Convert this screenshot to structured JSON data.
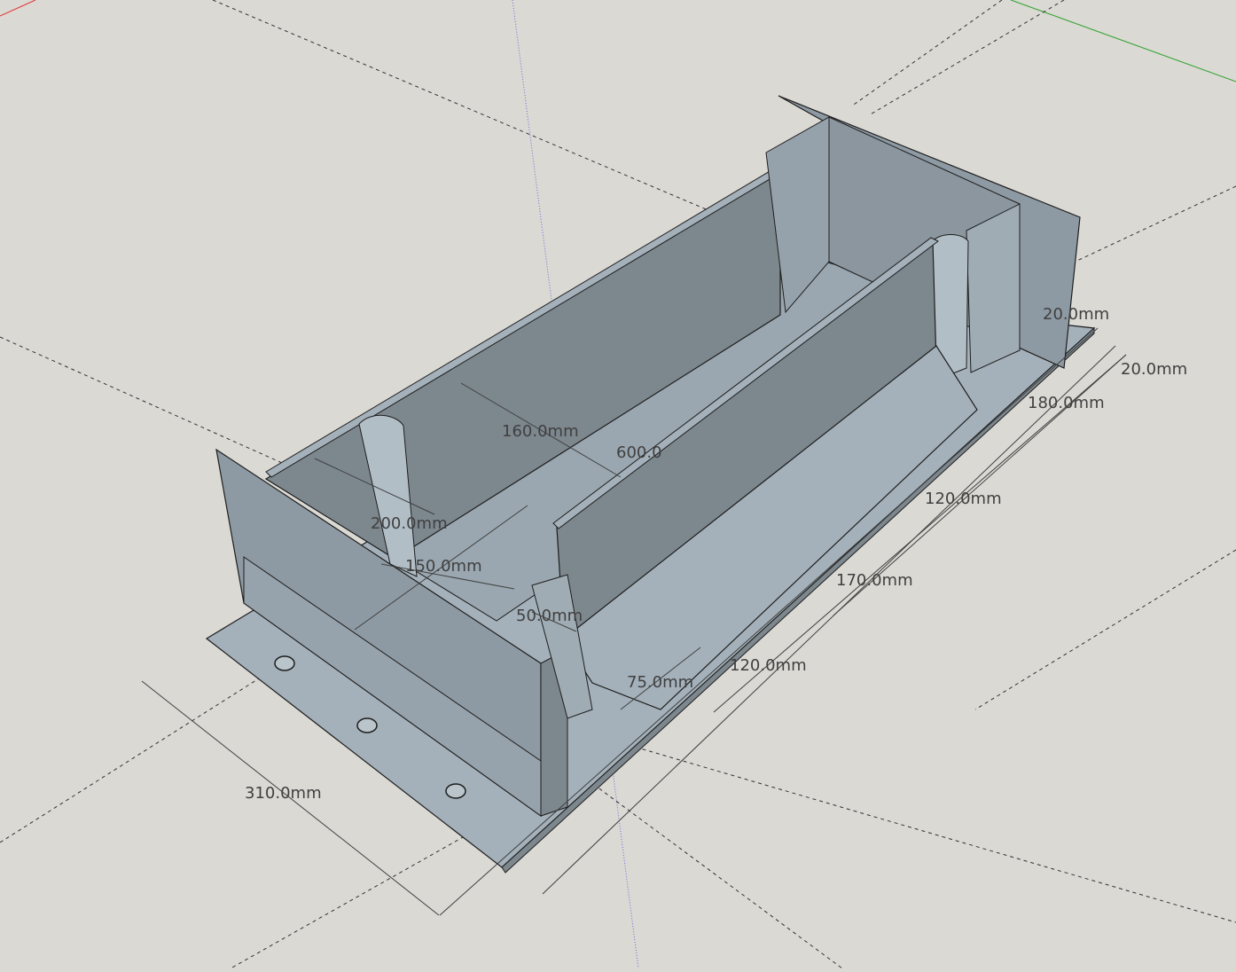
{
  "app": {
    "view": "3D modeling viewport"
  },
  "colors": {
    "background": "#dbd9d4",
    "face_light": "#a4b1ba",
    "face_mid": "#8e9aa3",
    "face_dark": "#7d878e",
    "edge": "#1e1e1e",
    "axis_red": "#e03131",
    "axis_green": "#2fa32f",
    "axis_blue": "#5b5bd6"
  },
  "dimensions": [
    "160.0mm",
    "600.0",
    "200.0mm",
    "150.0mm",
    "50.0mm",
    "75.0mm",
    "120.0mm",
    "120.0mm",
    "170.0mm",
    "180.0mm",
    "20.0mm",
    "20.0mm",
    "310.0mm"
  ]
}
